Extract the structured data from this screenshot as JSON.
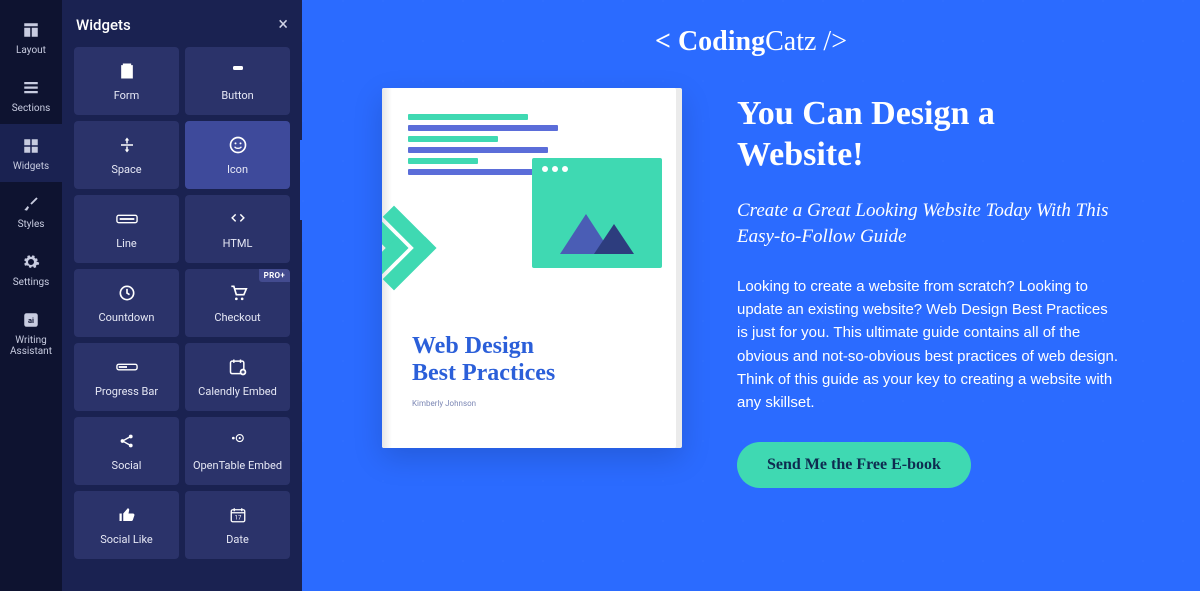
{
  "nav": {
    "items": [
      {
        "label": "Layout"
      },
      {
        "label": "Sections"
      },
      {
        "label": "Widgets"
      },
      {
        "label": "Styles"
      },
      {
        "label": "Settings"
      },
      {
        "label": "Writing Assistant"
      }
    ]
  },
  "panel": {
    "title": "Widgets",
    "widgets": [
      {
        "label": "Form"
      },
      {
        "label": "Button"
      },
      {
        "label": "Space"
      },
      {
        "label": "Icon"
      },
      {
        "label": "Line"
      },
      {
        "label": "HTML"
      },
      {
        "label": "Countdown"
      },
      {
        "label": "Checkout",
        "badge": "PRO+"
      },
      {
        "label": "Progress Bar"
      },
      {
        "label": "Calendly Embed"
      },
      {
        "label": "Social"
      },
      {
        "label": "OpenTable Embed"
      },
      {
        "label": "Social Like"
      },
      {
        "label": "Date"
      }
    ]
  },
  "page": {
    "brand_prefix": "< Coding",
    "brand_suffix": "Catz />",
    "book_title_l1": "Web Design",
    "book_title_l2": "Best Practices",
    "book_author": "Kimberly Johnson",
    "headline": "You Can Design a Website!",
    "subhead": "Create a Great Looking Website Today With This Easy-to-Follow Guide",
    "body": "Looking to create a website from scratch? Looking to update an existing website? Web Design Best Practices is just for you. This ultimate guide contains all of the obvious and not-so-obvious best practices of web design. Think of this guide as your key to creating a website with any skillset.",
    "cta": "Send Me the Free E-book"
  }
}
